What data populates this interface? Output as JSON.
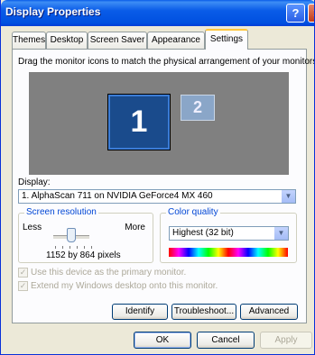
{
  "window": {
    "title": "Display Properties"
  },
  "tabs": [
    {
      "label": "Themes",
      "active": false
    },
    {
      "label": "Desktop",
      "active": false
    },
    {
      "label": "Screen Saver",
      "active": false
    },
    {
      "label": "Appearance",
      "active": false
    },
    {
      "label": "Settings",
      "active": true
    }
  ],
  "settings": {
    "instruction": "Drag the monitor icons to match the physical arrangement of your monitors.",
    "monitors": [
      {
        "number": "1",
        "selected": true
      },
      {
        "number": "2",
        "selected": false
      }
    ],
    "display_label": "Display:",
    "display_value": "1. AlphaScan 711 on NVIDIA GeForce4 MX 460",
    "resolution": {
      "group_label": "Screen resolution",
      "less_label": "Less",
      "more_label": "More",
      "value_text": "1152 by 864 pixels"
    },
    "color_quality": {
      "group_label": "Color quality",
      "value": "Highest (32 bit)"
    },
    "primary_checkbox": {
      "label": "Use this device as the primary monitor.",
      "checked": true,
      "enabled": false
    },
    "extend_checkbox": {
      "label": "Extend my Windows desktop onto this monitor.",
      "checked": true,
      "enabled": false
    },
    "buttons": {
      "identify": "Identify",
      "troubleshoot": "Troubleshoot...",
      "advanced": "Advanced"
    }
  },
  "dialog_buttons": {
    "ok": "OK",
    "cancel": "Cancel",
    "apply": "Apply"
  },
  "colors": {
    "titlebar": "#0a5ce8",
    "monitor_bg": "#808080",
    "selected_monitor": "#1a4b8c",
    "group_label": "#0046d5"
  },
  "icons": [
    "help-icon",
    "close-icon",
    "chevron-down-icon",
    "checkmark-icon"
  ]
}
